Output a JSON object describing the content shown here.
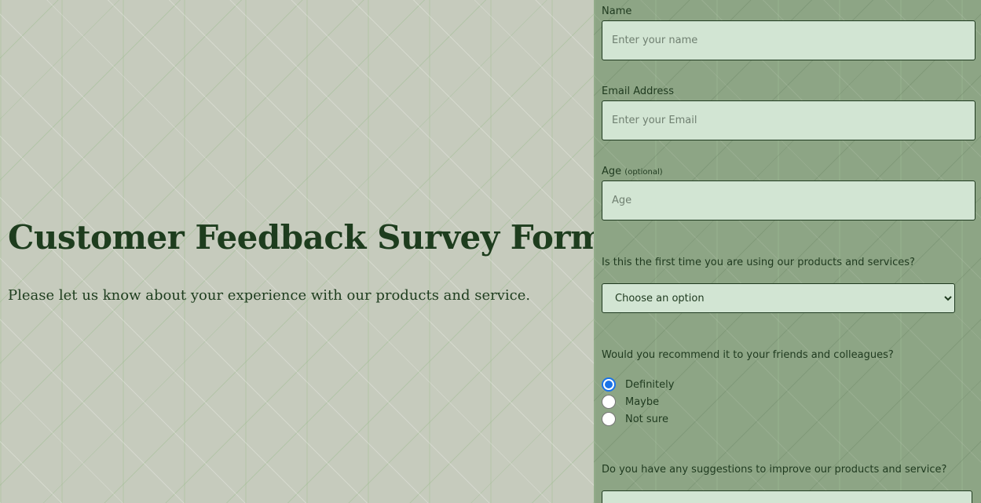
{
  "header": {
    "title": "Customer Feedback Survey Form",
    "subtitle": "Please let us know about your experience with our products and service."
  },
  "form": {
    "name": {
      "label": "Name",
      "placeholder": "Enter your name",
      "value": ""
    },
    "email": {
      "label": "Email Address",
      "placeholder": "Enter your Email",
      "value": ""
    },
    "age": {
      "label": "Age",
      "hint": "(optional)",
      "placeholder": "Age",
      "value": ""
    },
    "first_time": {
      "question": "Is this the first time you are using our products and services?",
      "selected": "Choose an option"
    },
    "recommend": {
      "question": "Would you recommend it to your friends and colleagues?",
      "options": [
        {
          "label": "Definitely",
          "checked": true
        },
        {
          "label": "Maybe",
          "checked": false
        },
        {
          "label": "Not sure",
          "checked": false
        }
      ]
    },
    "suggestions": {
      "question": "Do you have any suggestions to improve our products and service?",
      "value": ""
    }
  },
  "colors": {
    "left_background": "#c6cbbd",
    "right_background": "#8da585",
    "input_background": "#d2e5d3",
    "text_dark_green": "#1e3d1e",
    "radio_accent": "#1a73e8"
  }
}
